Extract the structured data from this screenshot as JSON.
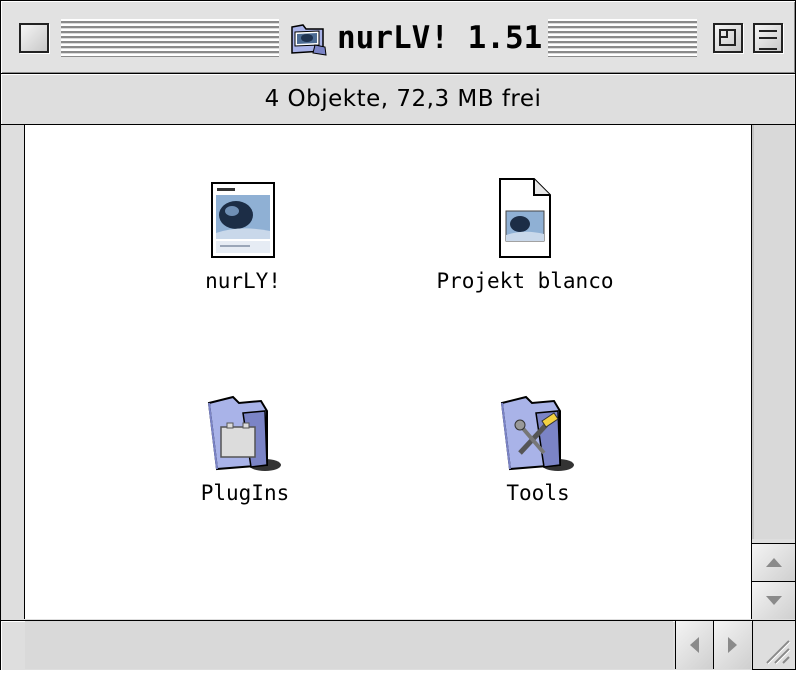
{
  "window": {
    "title": "nurLV! 1.51",
    "title_icon": "folder-icon"
  },
  "infobar": {
    "text": "4 Objekte, 72,3 MB frei"
  },
  "items": [
    {
      "label": "nurLY!",
      "icon": "application-icon"
    },
    {
      "label": "Projekt blanco",
      "icon": "document-icon"
    },
    {
      "label": "PlugIns",
      "icon": "plugins-folder-icon"
    },
    {
      "label": "Tools",
      "icon": "tools-folder-icon"
    }
  ],
  "colors": {
    "folder": "#a9b3e8",
    "folder_dark": "#7b84c6",
    "frame": "#dedede"
  }
}
